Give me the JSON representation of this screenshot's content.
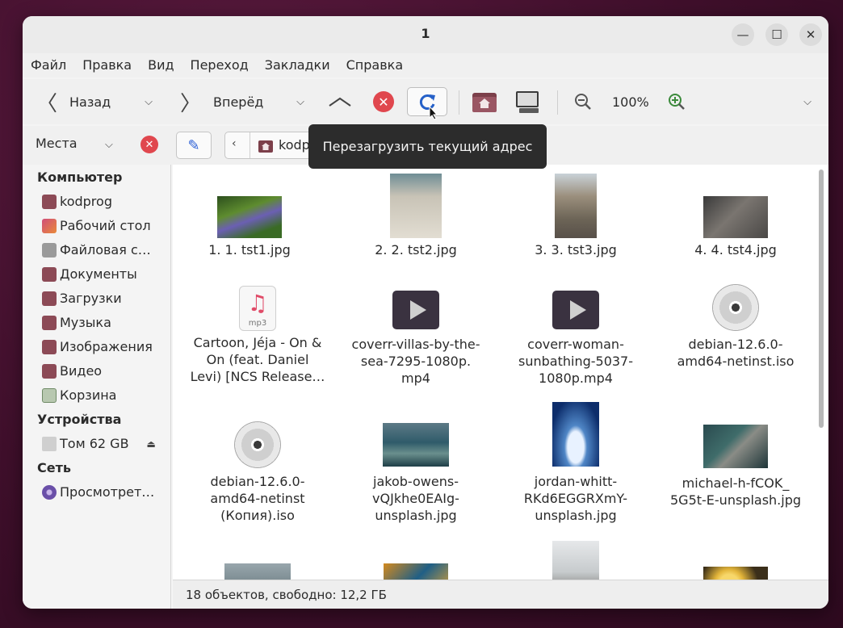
{
  "window": {
    "title": "1"
  },
  "menu": [
    "Файл",
    "Правка",
    "Вид",
    "Переход",
    "Закладки",
    "Справка"
  ],
  "toolbar": {
    "back_label": "Назад",
    "forward_label": "Вперёд",
    "zoom_level": "100%",
    "reload_tooltip": "Перезагрузить текущий адрес"
  },
  "location": {
    "places_label": "Места",
    "path_segment": "kodprog"
  },
  "sidebar": {
    "computer_header": "Компьютер",
    "computer_items": [
      "kodprog",
      "Рабочий стол",
      "Файловая с…",
      "Документы",
      "Загрузки",
      "Музыка",
      "Изображения",
      "Видео",
      "Корзина"
    ],
    "devices_header": "Устройства",
    "devices_items": [
      "Том 62 GB"
    ],
    "network_header": "Сеть",
    "network_items": [
      "Просмотрет…"
    ]
  },
  "files": [
    {
      "lines": [
        "1. 1. tst1.jpg"
      ],
      "kind": "image"
    },
    {
      "lines": [
        "2. 2. tst2.jpg"
      ],
      "kind": "image"
    },
    {
      "lines": [
        "3. 3. tst3.jpg"
      ],
      "kind": "image"
    },
    {
      "lines": [
        "4. 4. tst4.jpg"
      ],
      "kind": "image"
    },
    {
      "lines": [
        "Cartoon, Jéja - On &",
        "On (feat. Daniel",
        "Levi) [NCS Release…"
      ],
      "kind": "audio"
    },
    {
      "lines": [
        "coverr-villas-by-the-",
        "sea-7295-1080p.",
        "mp4"
      ],
      "kind": "video"
    },
    {
      "lines": [
        "coverr-woman-",
        "sunbathing-5037-",
        "1080p.mp4"
      ],
      "kind": "video"
    },
    {
      "lines": [
        "debian-12.6.0-",
        "amd64-netinst.iso"
      ],
      "kind": "disc"
    },
    {
      "lines": [
        "debian-12.6.0-",
        "amd64-netinst",
        "(Копия).iso"
      ],
      "kind": "disc"
    },
    {
      "lines": [
        "jakob-owens-",
        "vQJkhe0EAIg-",
        "unsplash.jpg"
      ],
      "kind": "image"
    },
    {
      "lines": [
        "jordan-whitt-",
        "RKd6EGGRXmY-",
        "unsplash.jpg"
      ],
      "kind": "image"
    },
    {
      "lines": [
        "michael-h-fCOK_",
        "5G5t-E-unsplash.jpg"
      ],
      "kind": "image"
    }
  ],
  "mp3_ext": "mp3",
  "status": {
    "text": "18 объектов, свободно: 12,2 ГБ"
  }
}
